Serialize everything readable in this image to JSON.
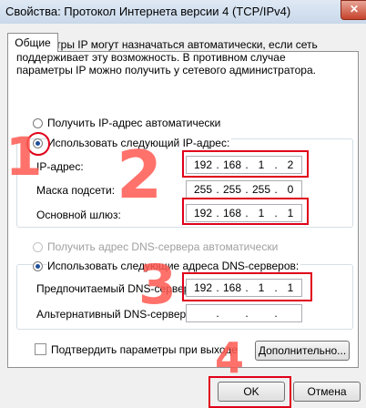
{
  "window": {
    "title": "Свойства: Протокол Интернета версии 4 (TCP/IPv4)",
    "close_glyph": "✕"
  },
  "tabs": [
    {
      "label": "Общие",
      "selected": true
    }
  ],
  "description": "Параметры IP могут назначаться автоматически, если сеть поддерживает эту возможность. В противном случае параметры IP можно получить у сетевого администратора.",
  "ip_section": {
    "auto_radio": {
      "label": "Получить IP-адрес автоматически",
      "selected": false
    },
    "manual_radio": {
      "label": "Использовать следующий IP-адрес:",
      "selected": true
    },
    "fields": [
      {
        "label": "IP-адрес:",
        "octets": [
          "192",
          "168",
          "1",
          "2"
        ]
      },
      {
        "label": "Маска подсети:",
        "octets": [
          "255",
          "255",
          "255",
          "0"
        ]
      },
      {
        "label": "Основной шлюз:",
        "octets": [
          "192",
          "168",
          "1",
          "1"
        ]
      }
    ]
  },
  "dns_section": {
    "auto_radio": {
      "label": "Получить адрес DNS-сервера автоматически",
      "selected": false,
      "enabled": false
    },
    "manual_radio": {
      "label": "Использовать следующие адреса DNS-серверов:",
      "selected": true
    },
    "fields": [
      {
        "label": "Предпочитаемый DNS-сервер:",
        "octets": [
          "192",
          "168",
          "1",
          "1"
        ]
      },
      {
        "label": "Альтернативный DNS-сервер:",
        "octets": [
          "",
          "",
          "",
          ""
        ]
      }
    ]
  },
  "validate_checkbox": {
    "label": "Подтвердить параметры при выходе",
    "checked": false
  },
  "advanced_button": "Дополнительно...",
  "ok_button": "OK",
  "cancel_button": "Отмена",
  "annotations": {
    "step1": "1",
    "step2": "2",
    "step3": "3",
    "step4": "4",
    "color": "#e0001a"
  },
  "colors": {
    "accent": "#1f4f99",
    "annotation": "#e0001a",
    "dialog_bg": "#f0f0f0"
  }
}
